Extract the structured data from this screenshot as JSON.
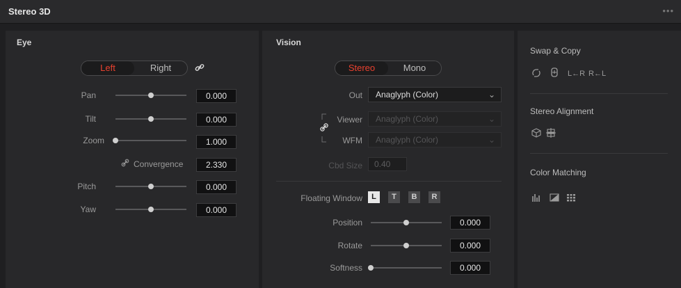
{
  "window": {
    "title": "Stereo 3D",
    "more_icon": "more-dots-icon",
    "more_glyph": "•••"
  },
  "eye": {
    "title": "Eye",
    "toggle": {
      "left": "Left",
      "right": "Right",
      "active": "Left"
    },
    "link_icon": "link-icon",
    "link_glyph": "⚗",
    "params": [
      {
        "label": "Pan",
        "value": "0.000",
        "level": 0.5
      },
      {
        "label": "Tilt",
        "value": "0.000",
        "level": 0.5
      },
      {
        "label": "Zoom",
        "value": "1.000",
        "level": 0.0
      },
      {
        "label": "Convergence",
        "value": "2.330",
        "level": null
      },
      {
        "label": "Pitch",
        "value": "0.000",
        "level": 0.5
      },
      {
        "label": "Yaw",
        "value": "0.000",
        "level": 0.5
      }
    ],
    "convergence_icon_glyph": "✐"
  },
  "vision": {
    "title": "Vision",
    "toggle": {
      "stereo": "Stereo",
      "mono": "Mono",
      "active": "Stereo"
    },
    "out": {
      "label": "Out",
      "value": "Anaglyph (Color)"
    },
    "viewer": {
      "label": "Viewer",
      "value": "Anaglyph (Color)"
    },
    "wfm": {
      "label": "WFM",
      "value": "Anaglyph (Color)"
    },
    "cbd_size": {
      "label": "Cbd Size",
      "value": "0.40"
    },
    "chevron": "⌄",
    "floating_window": {
      "label": "Floating Window",
      "buttons": [
        "L",
        "T",
        "B",
        "R"
      ],
      "active": "L"
    },
    "params": [
      {
        "label": "Position",
        "value": "0.000",
        "level": 0.5
      },
      {
        "label": "Rotate",
        "value": "0.000",
        "level": 0.5
      },
      {
        "label": "Softness",
        "value": "0.000",
        "level": 0.0
      }
    ]
  },
  "right": {
    "swap_copy": {
      "title": "Swap & Copy",
      "l_to_r": "L←R",
      "r_to_l": "R←L"
    },
    "stereo_alignment": {
      "title": "Stereo Alignment"
    },
    "color_matching": {
      "title": "Color Matching"
    }
  }
}
